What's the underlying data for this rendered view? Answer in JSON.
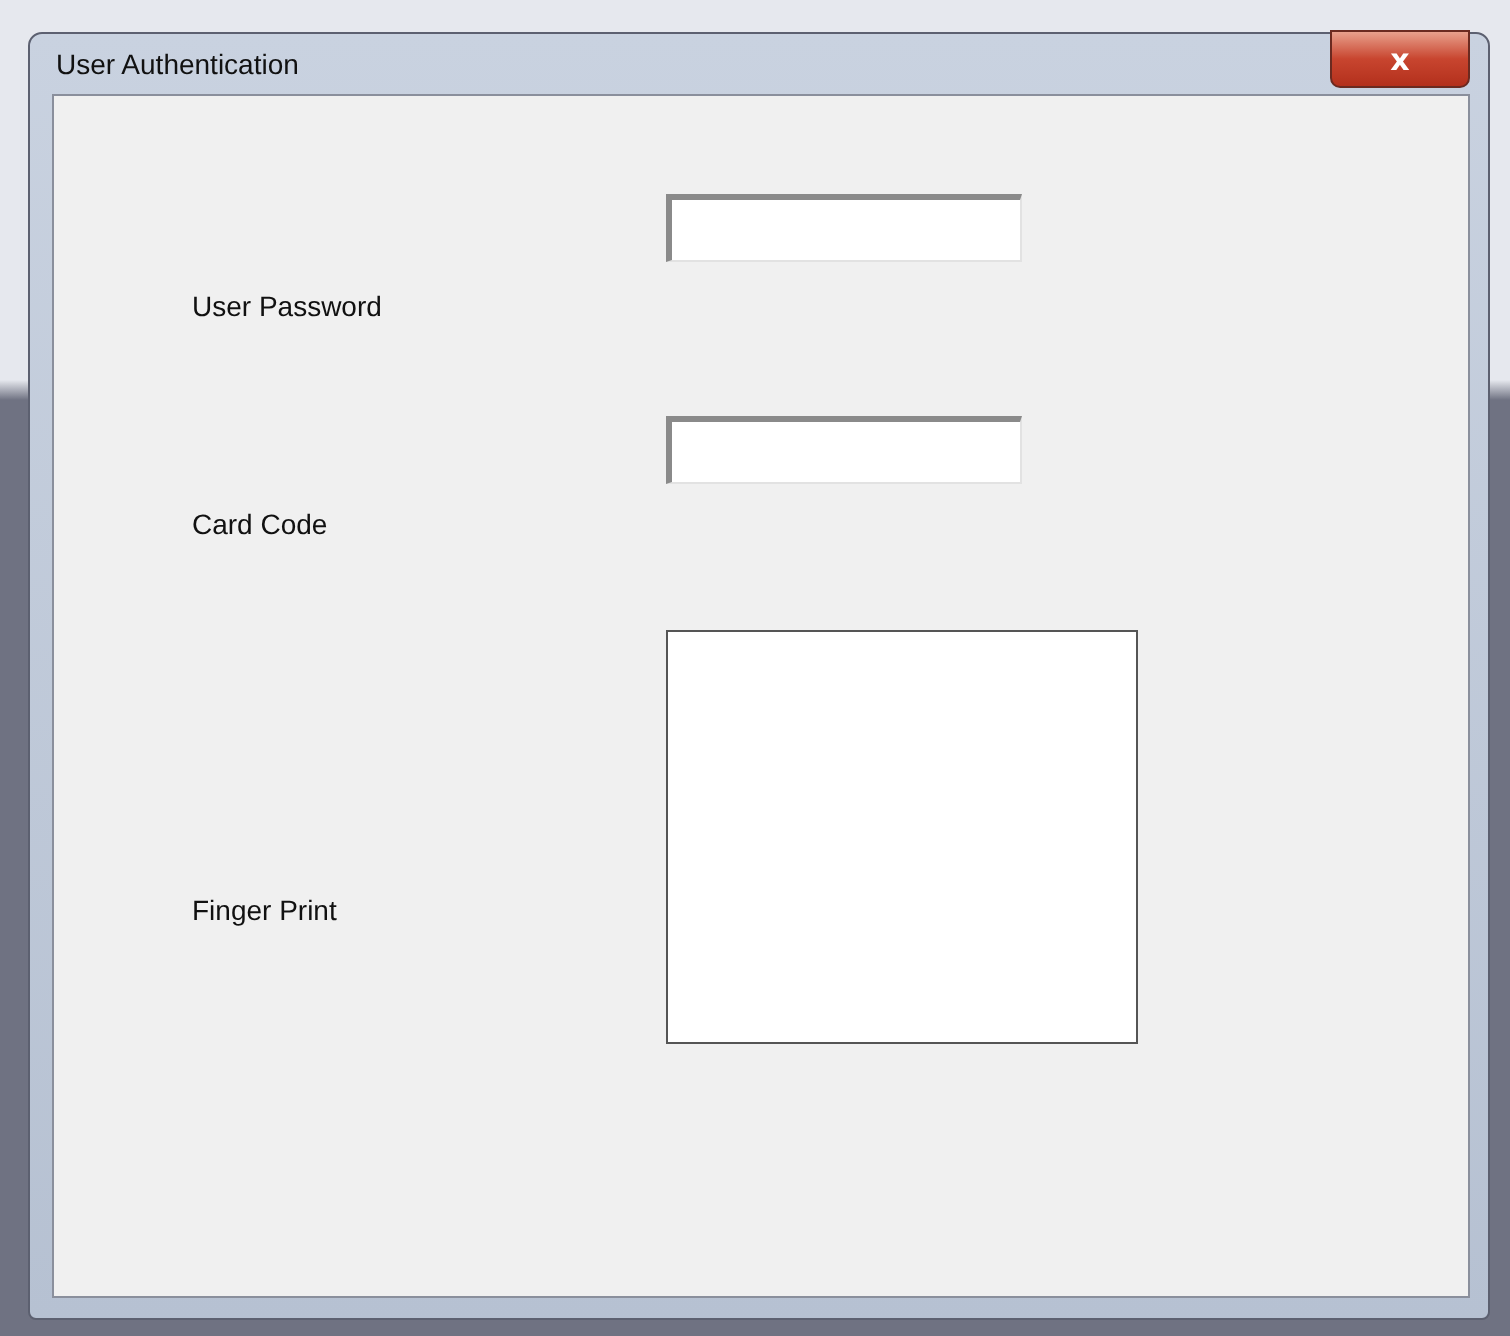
{
  "window": {
    "title": "User Authentication",
    "close_label": "x"
  },
  "fields": [
    {
      "kind": "text",
      "label": "User Password"
    },
    {
      "kind": "text",
      "label": "Card Code"
    },
    {
      "kind": "fingerprint",
      "label": "Finger Print"
    }
  ]
}
